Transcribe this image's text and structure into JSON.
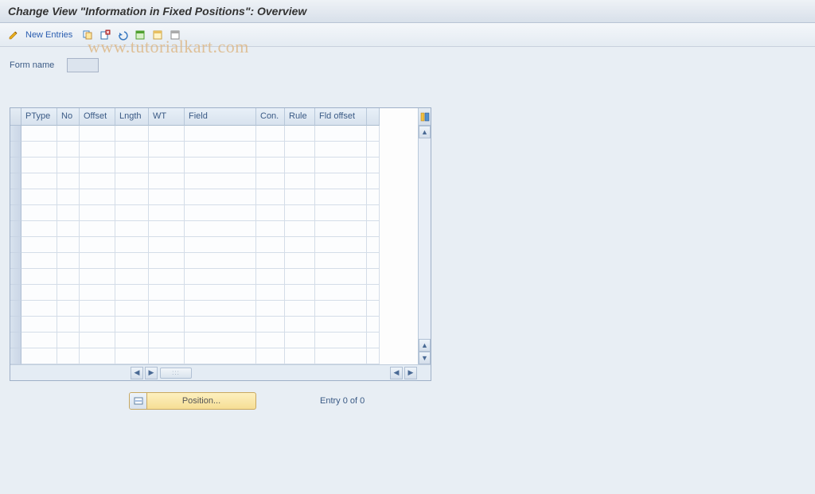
{
  "title": "Change View \"Information in Fixed Positions\": Overview",
  "toolbar": {
    "new_entries_label": "New Entries",
    "icons": {
      "pencil": "toggle-change-icon",
      "copy": "copy-as-icon",
      "delete": "delete-icon",
      "undo": "undo-icon",
      "select_all": "select-all-icon",
      "select_block": "select-block-icon",
      "deselect": "deselect-all-icon"
    }
  },
  "watermark": "www.tutorialkart.com",
  "form": {
    "field_label": "Form name",
    "field_value": ""
  },
  "table": {
    "columns": [
      "PType",
      "No",
      "Offset",
      "Lngth",
      "WT",
      "Field",
      "Con.",
      "Rule",
      "Fld offset"
    ],
    "row_count": 15
  },
  "position_button": "Position...",
  "entry_status": "Entry 0 of 0"
}
